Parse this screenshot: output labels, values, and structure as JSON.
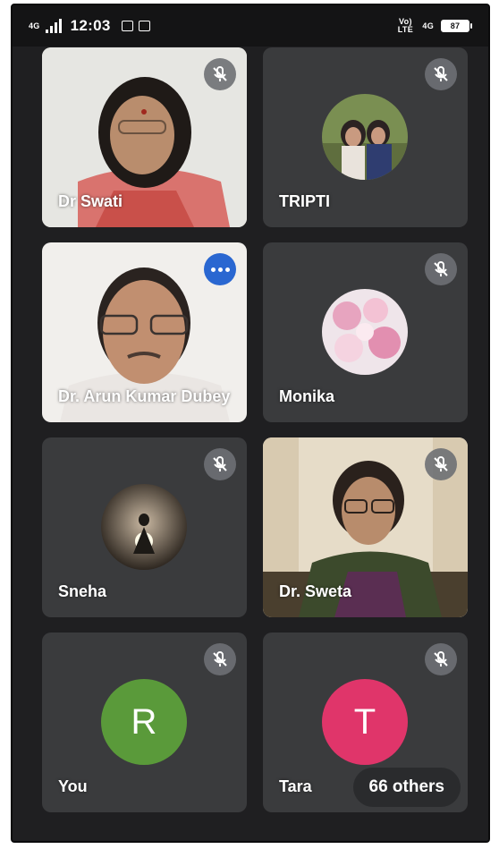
{
  "status_bar": {
    "network": "4G",
    "time": "12:03",
    "right_tags": [
      "Vo) LTE",
      "4G"
    ],
    "battery": "87"
  },
  "participants": [
    {
      "name": "Dr Swati",
      "muted": true,
      "media": "video"
    },
    {
      "name": "TRIPTI",
      "muted": true,
      "media": "avatar-photo"
    },
    {
      "name": "Dr. Arun Kumar Dubey",
      "muted": false,
      "speaking": true,
      "media": "video"
    },
    {
      "name": "Monika",
      "muted": true,
      "media": "avatar-photo"
    },
    {
      "name": "Sneha",
      "muted": true,
      "media": "avatar-photo"
    },
    {
      "name": "Dr. Sweta",
      "muted": true,
      "media": "video"
    },
    {
      "name": "You",
      "muted": true,
      "media": "letter",
      "letter": "R",
      "color": "#5a9a3a"
    },
    {
      "name": "Tara",
      "muted": true,
      "media": "letter",
      "letter": "T",
      "color": "#e0356a"
    }
  ],
  "others_button": "66 others",
  "colors": {
    "background": "#1f1f21",
    "tile": "#3a3b3d",
    "speaking_indicator": "#2a67d1"
  }
}
